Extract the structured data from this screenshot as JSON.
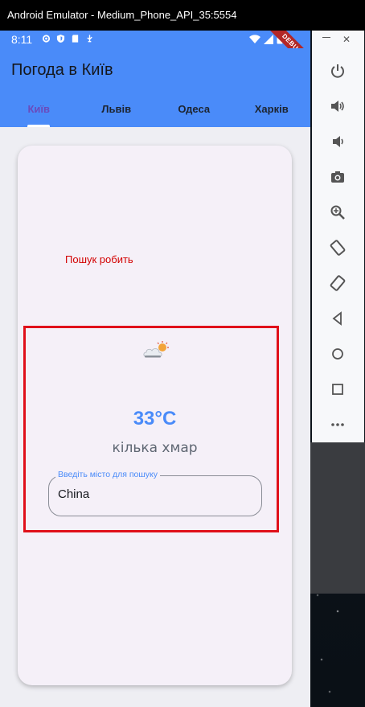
{
  "window": {
    "title": "Android Emulator - Medium_Phone_API_35:5554"
  },
  "status_bar": {
    "time": "8:11",
    "debug_banner": "DEBUG"
  },
  "app_bar": {
    "title": "Погода в Київ"
  },
  "tabs": [
    {
      "label": "Київ",
      "active": true
    },
    {
      "label": "Львів",
      "active": false
    },
    {
      "label": "Одеса",
      "active": false
    },
    {
      "label": "Харків",
      "active": false
    }
  ],
  "card": {
    "search_message": "Пошук робить",
    "weather_icon": "sun-behind-cloud-icon",
    "temperature": "33°C",
    "description": "кілька хмар",
    "search_field": {
      "label": "Введіть місто для пошуку",
      "value": "China"
    }
  },
  "emulator_toolbar": {
    "buttons": [
      "power-icon",
      "volume-up-icon",
      "volume-down-icon",
      "camera-icon",
      "zoom-icon",
      "rotate-left-icon",
      "rotate-right-icon",
      "back-icon",
      "home-icon",
      "overview-icon",
      "more-icon"
    ]
  },
  "colors": {
    "accent": "#4a8bf9",
    "active_tab": "#6a4bbd",
    "error": "#d30000",
    "highlight": "#e0101a"
  }
}
